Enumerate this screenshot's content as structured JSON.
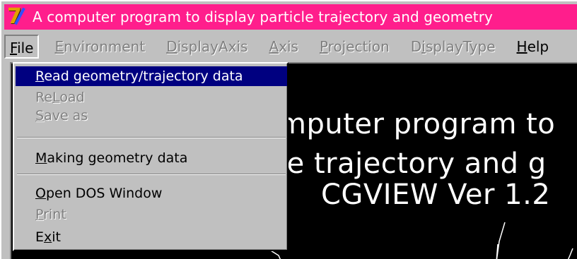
{
  "window": {
    "title": "A computer program to display particle trajectory and geometry"
  },
  "menubar": [
    {
      "label": "File",
      "accel": "F",
      "rest": "ile",
      "state": "open"
    },
    {
      "label": "Environment",
      "accel": "E",
      "rest": "nvironment",
      "state": "disabled"
    },
    {
      "label": "DisplayAxis",
      "accel": "D",
      "rest": "isplayAxis",
      "state": "disabled"
    },
    {
      "label": "Axis",
      "accel": "A",
      "rest": "xis",
      "state": "disabled"
    },
    {
      "label": "Projection",
      "accel": "P",
      "rest": "rojection",
      "state": "disabled"
    },
    {
      "label": "DisplayType",
      "accel": "i",
      "pre": "D",
      "rest": "splayType",
      "state": "disabled"
    },
    {
      "label": "Help",
      "accel": "H",
      "rest": "elp",
      "state": "enabled"
    }
  ],
  "file_menu": {
    "items": [
      {
        "accel": "R",
        "rest": "ead geometry/trajectory data",
        "state": "selected"
      },
      {
        "pre": "Re",
        "accel": "L",
        "rest": "oad",
        "state": "disabled"
      },
      {
        "accel": "S",
        "rest": "ave as",
        "state": "disabled"
      },
      {
        "accel": "M",
        "rest": "aking geometry data",
        "state": "enabled"
      },
      {
        "accel": "O",
        "rest": "pen DOS Window",
        "state": "enabled"
      },
      {
        "accel": "P",
        "rest": "rint",
        "state": "disabled"
      },
      {
        "pre": "E",
        "accel": "x",
        "rest": "it",
        "state": "enabled"
      }
    ]
  },
  "canvas": {
    "lines": [
      "mputer program to",
      "le trajectory and g",
      "CGVIEW Ver 1.2"
    ]
  },
  "colors": {
    "title_bar": "#ff1e8c",
    "menu_bg": "#c0c0c0",
    "selection": "#000080",
    "canvas_bg": "#000000"
  }
}
